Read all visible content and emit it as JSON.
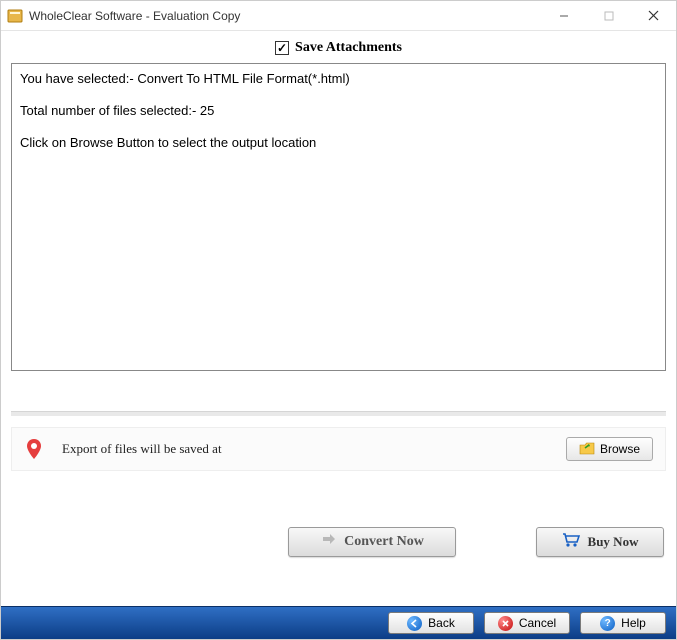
{
  "window": {
    "title": "WholeClear Software - Evaluation Copy"
  },
  "checkbox": {
    "save_attachments_label": "Save Attachments",
    "checked": true
  },
  "summary": {
    "line1": "You have selected:- Convert To HTML File Format(*.html)",
    "line2": "Total number of files selected:- 25",
    "line3": "Click on Browse Button to select the output location"
  },
  "export": {
    "text": "Export of files will be saved at",
    "browse_label": "Browse"
  },
  "actions": {
    "convert_label": "Convert Now",
    "buy_label": "Buy Now"
  },
  "footer": {
    "back_label": "Back",
    "cancel_label": "Cancel",
    "help_label": "Help"
  }
}
